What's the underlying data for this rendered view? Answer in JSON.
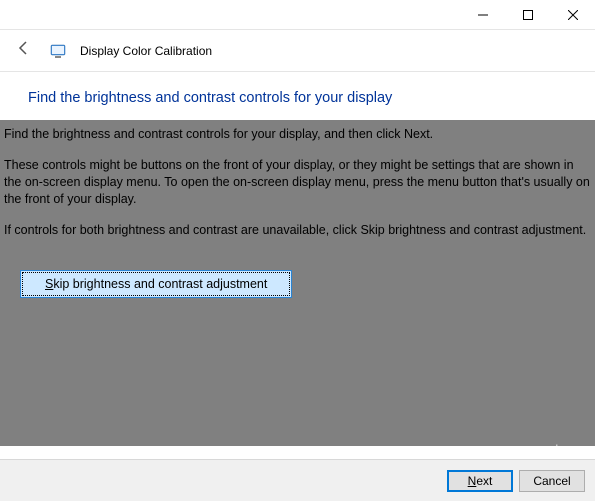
{
  "window": {
    "app_title": "Display Color Calibration"
  },
  "heading": "Find the brightness and contrast controls for your display",
  "body": {
    "p1": "Find the brightness and contrast controls for your display, and then click Next.",
    "p2": "These controls might be buttons on the front of your display, or they might be settings that are shown in the on-screen display menu. To open the on-screen display menu, press the menu button that's usually on the front of your display.",
    "p3": "If controls for both brightness and contrast are unavailable, click Skip brightness and contrast adjustment."
  },
  "buttons": {
    "skip_prefix": "S",
    "skip_rest": "kip brightness and contrast adjustment",
    "next_prefix": "N",
    "next_rest": "ext",
    "cancel": "Cancel"
  },
  "watermark": "wsxdn.com"
}
